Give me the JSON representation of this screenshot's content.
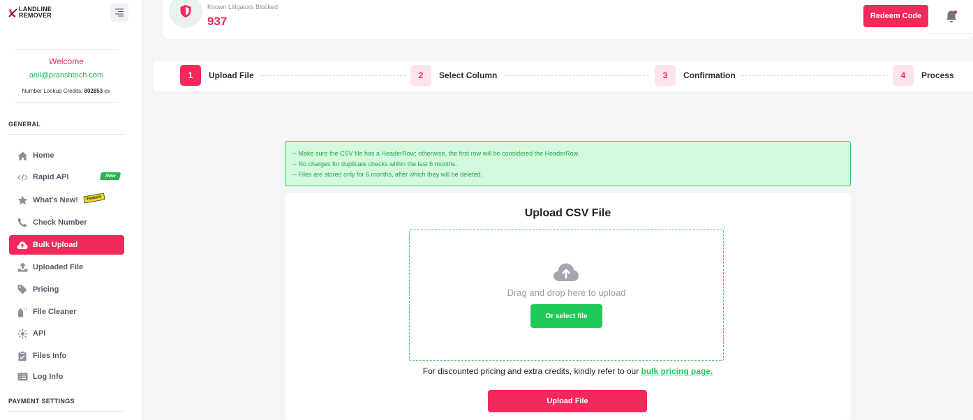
{
  "sidebar": {
    "logo": {
      "line1": "LANDLINE",
      "line2": "REMOVER"
    },
    "welcome": "Welcome",
    "email": "anil@pranshtech.com",
    "credits_label": "Number Lookup Credits:",
    "credits_value": "802853",
    "general_title": "GENERAL",
    "payment_title": "PAYMENT SETTINGS",
    "items": [
      {
        "label": "Home",
        "icon": "home-icon"
      },
      {
        "label": "Rapid API",
        "icon": "code-icon",
        "badge": "New"
      },
      {
        "label": "What's New!",
        "icon": "star-icon",
        "badge": "Feature"
      },
      {
        "label": "Check Number",
        "icon": "phone-icon"
      },
      {
        "label": "Bulk Upload",
        "icon": "cloud-upload-icon",
        "active": true
      },
      {
        "label": "Uploaded File",
        "icon": "upload-icon"
      },
      {
        "label": "Pricing",
        "icon": "tag-icon"
      },
      {
        "label": "File Cleaner",
        "icon": "spray-icon"
      },
      {
        "label": "API",
        "icon": "api-icon"
      },
      {
        "label": "Files Info",
        "icon": "clipboard-icon"
      },
      {
        "label": "Log Info",
        "icon": "list-icon"
      }
    ]
  },
  "header": {
    "litigators_label": "Known Litigators Blocked",
    "litigators_count": "937",
    "redeem_label": "Redeem Code"
  },
  "steps": [
    {
      "num": "1",
      "label": "Upload File",
      "active": true
    },
    {
      "num": "2",
      "label": "Select Column"
    },
    {
      "num": "3",
      "label": "Confirmation"
    },
    {
      "num": "4",
      "label": "Process"
    }
  ],
  "info": [
    "-- Make sure the CSV file has a HeaderRow; otherwise, the first row will be considered the HeaderRow.",
    "-- No charges for duplicate checks within the last 6 months.",
    "-- Files are stored only for 6 months, after which they will be deleted."
  ],
  "upload": {
    "title": "Upload CSV File",
    "drop_text": "Drag and drop here to upload",
    "select_label": "Or select file",
    "pricing_text": "For discounted pricing and extra credits, kindly refer to our",
    "pricing_link": "bulk pricing page.",
    "upload_label": "Upload File"
  },
  "colors": {
    "accent": "#f2295b",
    "green": "#1ec95a"
  }
}
